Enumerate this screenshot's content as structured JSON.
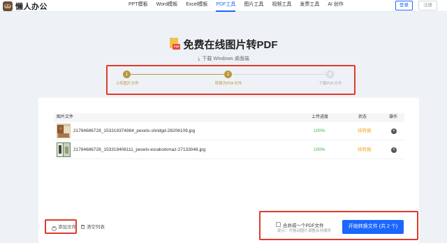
{
  "brand": {
    "name": "懒人办公"
  },
  "nav": {
    "items": [
      {
        "label": "PPT模板"
      },
      {
        "label": "Word模板"
      },
      {
        "label": "Excel模板"
      },
      {
        "label": "PDF工具"
      },
      {
        "label": "图片工具"
      },
      {
        "label": "视频工具"
      },
      {
        "label": "发票工具"
      },
      {
        "label": "AI 创作"
      }
    ],
    "active": "PDF工具",
    "login_label": "登录",
    "register_label": "注册"
  },
  "hero": {
    "icon_badge": "PDF",
    "title": "免费在线图片转PDF",
    "download_label": "下载 Windows 桌面端"
  },
  "steps": [
    {
      "num": "1",
      "label": "上传图片文件",
      "state": "done"
    },
    {
      "num": "2",
      "label": "转换为PDF文件",
      "state": "done"
    },
    {
      "num": "3",
      "label": "下载PDF文件",
      "state": "todo"
    }
  ],
  "table": {
    "headers": {
      "file": "图片文件",
      "progress": "上传进度",
      "status": "状态",
      "action": "操作"
    },
    "rows": [
      {
        "filename": "21784686728_153319374984_pexels-shridgd-28206109.jpg",
        "progress": "100%",
        "status": "待转换"
      },
      {
        "filename": "21784686728_153319406111_pexels-esrakorkmaz-27133048.jpg",
        "progress": "100%",
        "status": "待转换"
      }
    ]
  },
  "actions": {
    "add_label": "添加文件",
    "clear_label": "清空列表",
    "merge_label": "合并成一个PDF文件",
    "merge_hint": "提示：可拖动图片调整合并顺序",
    "convert_label": "开始转换文件 (共 2 个)"
  },
  "colors": {
    "accent": "#1a66ff",
    "step": "#b8973f",
    "success": "#36b24a",
    "pending": "#f5a623",
    "highlight": "#e0392b"
  }
}
